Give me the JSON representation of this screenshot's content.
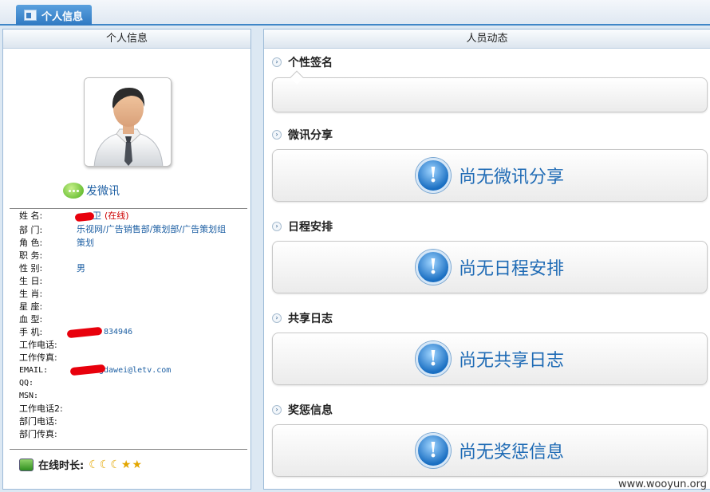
{
  "tab": {
    "label": "个人信息",
    "icon": "profile-card-icon"
  },
  "left_panel": {
    "title": "个人信息",
    "weibo_label": "发微讯",
    "fields": [
      {
        "label": "姓 名:",
        "value": "卫",
        "online": "(在线)"
      },
      {
        "label": "部 门:",
        "value": "乐视网/广告销售部/策划部/广告策划组"
      },
      {
        "label": "角 色:",
        "value": "策划"
      },
      {
        "label": "职 务:",
        "value": ""
      },
      {
        "label": "性 别:",
        "value": "男"
      },
      {
        "label": "生 日:",
        "value": ""
      },
      {
        "label": "生 肖:",
        "value": ""
      },
      {
        "label": "星 座:",
        "value": ""
      },
      {
        "label": "血 型:",
        "value": ""
      },
      {
        "label": "手 机:",
        "value": "834946"
      },
      {
        "label": "工作电话:",
        "value": ""
      },
      {
        "label": "工作传真:",
        "value": ""
      },
      {
        "label": "EMAIL:",
        "value": "gdawei@letv.com"
      },
      {
        "label": "QQ:",
        "value": ""
      },
      {
        "label": "MSN:",
        "value": ""
      },
      {
        "label": "工作电话2:",
        "value": ""
      },
      {
        "label": "部门电话:",
        "value": ""
      },
      {
        "label": "部门传真:",
        "value": ""
      }
    ],
    "online_time_label": "在线时长:"
  },
  "right_panel": {
    "title": "人员动态",
    "sections": [
      {
        "title": "个性签名",
        "empty_text": ""
      },
      {
        "title": "微讯分享",
        "empty_text": "尚无微讯分享"
      },
      {
        "title": "日程安排",
        "empty_text": "尚无日程安排"
      },
      {
        "title": "共享日志",
        "empty_text": "尚无共享日志"
      },
      {
        "title": "奖惩信息",
        "empty_text": "尚无奖惩信息"
      }
    ]
  },
  "watermark": "www.wooyun.org",
  "colors": {
    "accent": "#2f79c2",
    "link": "#1d5fa3",
    "online": "#cc0000",
    "redaction": "#e8000c"
  }
}
